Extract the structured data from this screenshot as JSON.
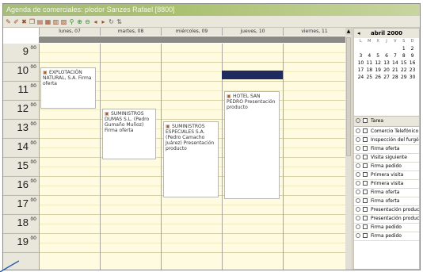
{
  "window": {
    "title": "Agenda de comerciales: plodor Sanzes Rafael [8800]"
  },
  "toolbar": {
    "icons": [
      "new-icon",
      "edit-icon",
      "delete-icon",
      "copy-icon",
      "print-icon",
      "week-icon",
      "day-icon",
      "month-icon",
      "find-icon",
      "zoom-in-icon",
      "zoom-out-icon",
      "prev-icon",
      "next-icon",
      "refresh-icon",
      "sort-icon"
    ]
  },
  "calendar": {
    "days": [
      "lunes, 07",
      "martes, 08",
      "miércoles, 09",
      "jueves, 10",
      "viernes, 11"
    ],
    "hours": [
      {
        "h": "9",
        "m": "00"
      },
      {
        "h": "10",
        "m": "00"
      },
      {
        "h": "11",
        "m": "00"
      },
      {
        "h": "12",
        "m": "00"
      },
      {
        "h": "13",
        "m": "00"
      },
      {
        "h": "14",
        "m": "00"
      },
      {
        "h": "15",
        "m": "00"
      },
      {
        "h": "16",
        "m": "00"
      },
      {
        "h": "17",
        "m": "00"
      },
      {
        "h": "18",
        "m": "00"
      },
      {
        "h": "19",
        "m": "00"
      }
    ],
    "appointments": [
      {
        "id": "a1",
        "text": "EXPLOTACIÓN NATURAL, S.A. Firma oferta"
      },
      {
        "id": "a2",
        "text": "SUMINISTROS DUMAS S.L. (Pedro Gumaño Muñoz) Firma oferta"
      },
      {
        "id": "a3",
        "text": "SUMINISTROS ESPECIALES S.A. (Pedro Camacho Juárez) Presentación producto"
      },
      {
        "id": "a4",
        "text": "HOTEL SAN PEDRO Presentación producto"
      }
    ]
  },
  "minicalendar": {
    "month": "abril 2000",
    "prev": "◂",
    "dow": [
      "L",
      "M",
      "X",
      "J",
      "V",
      "S",
      "D"
    ],
    "weeks": [
      [
        "",
        "",
        "",
        "",
        "",
        "1",
        "2"
      ],
      [
        "3",
        "4",
        "5",
        "6",
        "7",
        "8",
        "9"
      ],
      [
        "10",
        "11",
        "12",
        "13",
        "14",
        "15",
        "16"
      ],
      [
        "17",
        "18",
        "19",
        "20",
        "21",
        "22",
        "23"
      ],
      [
        "24",
        "25",
        "26",
        "27",
        "28",
        "29",
        "30"
      ]
    ]
  },
  "tasks": {
    "header": "Tarea",
    "items": [
      "Comercio Telefónico",
      "Inspección del furgón",
      "Firma oferta",
      "Visita siguiente",
      "Firma pedido",
      "Primera visita",
      "Primera visita",
      "Firma oferta",
      "Firma oferta",
      "Presentación producto",
      "Presentación producto",
      "Firma pedido",
      "Firma pedido"
    ]
  },
  "colors": {
    "titlebar": "#a9c06f",
    "slot": "#fffbe0",
    "darkbar": "#1f2a5e",
    "accent": "#1a5aa8"
  }
}
